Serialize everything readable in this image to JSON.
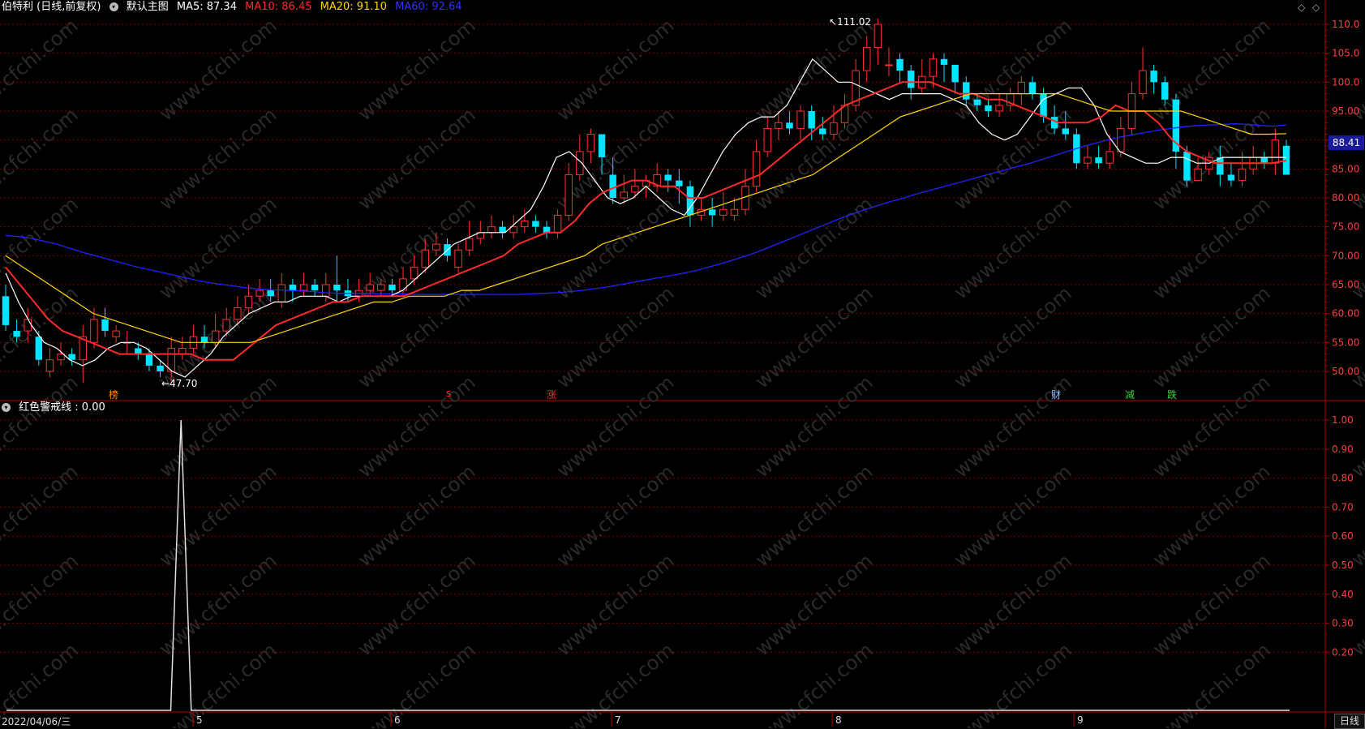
{
  "header": {
    "stock_name": "伯特利 (日线,前复权)",
    "chart_label": "默认主图",
    "ma": [
      {
        "label": "MA5: 87.34",
        "color": "#ffffff"
      },
      {
        "label": "MA10: 86.45",
        "color": "#ff2a2a"
      },
      {
        "label": "MA20: 91.10",
        "color": "#ffd700"
      },
      {
        "label": "MA60: 92.64",
        "color": "#2323ff"
      }
    ]
  },
  "indicator": {
    "label": "红色警戒线 : 0.00"
  },
  "price_axis": {
    "ticks": [
      "110.0",
      "105.0",
      "100.0",
      "95.00",
      "90.00",
      "85.00",
      "80.00",
      "75.00",
      "70.00",
      "65.00",
      "60.00",
      "55.00",
      "50.00"
    ],
    "current_price": "88.41"
  },
  "indicator_axis": {
    "ticks": [
      "1.00",
      "0.90",
      "0.80",
      "0.70",
      "0.60",
      "0.50",
      "0.40",
      "0.30",
      "0.20"
    ]
  },
  "annotations": {
    "high": "111.02",
    "low": "47.70"
  },
  "event_marks": [
    {
      "text": "榜",
      "color": "#ff8c00"
    },
    {
      "text": "s",
      "color": "#ff2a2a"
    },
    {
      "text": "涨",
      "color": "#ff2a2a"
    },
    {
      "text": "财",
      "color": "#8fb8ff"
    },
    {
      "text": "减",
      "color": "#3ad63a"
    },
    {
      "text": "跌",
      "color": "#3ad63a"
    }
  ],
  "bottom_bar": {
    "start_date": "2022/04/06/三",
    "months": [
      "5",
      "6",
      "7",
      "8",
      "9"
    ],
    "period_tab": "日线"
  },
  "watermark": "www.cfchi.com",
  "colors": {
    "up": "#ff3232",
    "down": "#00e5ff",
    "grid": "#7a0000",
    "axis": "#b00000",
    "ma5": "#ffffff",
    "ma10": "#ff2a2a",
    "ma20": "#ffd700",
    "ma60": "#2323ff"
  },
  "chart_data": [
    {
      "type": "candlestick",
      "title": "伯特利 (日线,前复权)",
      "ylim": [
        46,
        113
      ],
      "x_start": "2022/04/06",
      "series": [
        {
          "name": "MA60",
          "values": [
            73.5,
            73.3,
            73.0,
            72.5,
            72.0,
            71.3,
            70.6,
            70.0,
            69.4,
            68.8,
            68.2,
            67.7,
            67.2,
            66.7,
            66.2,
            65.7,
            65.3,
            65.0,
            64.7,
            64.4,
            64.2,
            64.1,
            64.0,
            63.9,
            63.8,
            63.6,
            63.5,
            63.5,
            63.5,
            63.4,
            63.4,
            63.4,
            63.3,
            63.3,
            63.3,
            63.3,
            63.3,
            63.3,
            63.3,
            63.3,
            63.3,
            63.4,
            63.5,
            63.6,
            63.8,
            64.0,
            64.3,
            64.6,
            65.0,
            65.4,
            65.8,
            66.2,
            66.6,
            67.0,
            67.5,
            68.1,
            68.7,
            69.4,
            70.1,
            70.9,
            71.8,
            72.7,
            73.6,
            74.5,
            75.4,
            76.3,
            77.1,
            77.9,
            78.6,
            79.3,
            79.9,
            80.6,
            81.2,
            81.8,
            82.4,
            83.0,
            83.6,
            84.2,
            84.8,
            85.4,
            86.0,
            86.7,
            87.4,
            88.1,
            88.8,
            89.4,
            90.0,
            90.5,
            90.9,
            91.3,
            91.7,
            92.0,
            92.3,
            92.5,
            92.6,
            92.7,
            92.8,
            92.7,
            92.5,
            92.4,
            92.6
          ]
        },
        {
          "name": "MA5",
          "values": [
            67,
            62,
            58,
            55,
            54,
            52,
            51,
            52,
            54,
            55,
            55,
            54,
            52,
            50,
            49,
            51,
            53,
            56,
            58,
            60,
            61,
            62,
            62,
            63,
            63,
            63,
            62,
            63,
            63,
            63,
            63,
            64,
            66,
            68,
            70,
            72,
            73,
            74,
            74,
            74,
            76,
            78,
            82,
            87,
            88,
            86,
            83,
            80,
            79,
            80,
            82,
            80,
            78,
            77,
            80,
            84,
            88,
            91,
            93,
            94,
            94,
            96,
            100,
            104,
            102,
            100,
            100,
            99,
            98,
            97,
            98,
            98,
            98,
            98,
            97,
            96,
            93,
            91,
            90,
            91,
            94,
            97,
            98,
            99,
            99,
            96,
            91,
            88,
            87,
            86,
            86,
            87,
            87,
            86,
            86,
            87,
            87,
            87,
            87,
            87,
            87
          ]
        },
        {
          "name": "MA10",
          "values": [
            68,
            65,
            62,
            59,
            57,
            56,
            55,
            54,
            53,
            53,
            53,
            53,
            53,
            53,
            52,
            52,
            52,
            54,
            56,
            58,
            59,
            60,
            61,
            62,
            62,
            63,
            63,
            63,
            63,
            64,
            65,
            66,
            67,
            68,
            69,
            70,
            72,
            73,
            74,
            74,
            76,
            79,
            81,
            82,
            83,
            83,
            82,
            82,
            80,
            80,
            81,
            82,
            83,
            84,
            86,
            88,
            90,
            92,
            94,
            96,
            97,
            98,
            99,
            100,
            100,
            100,
            99,
            98,
            98,
            97,
            97,
            96,
            95,
            94,
            93,
            93,
            93,
            94,
            96,
            95,
            95,
            93,
            90,
            88,
            87,
            86,
            86,
            86,
            86,
            86,
            86.45
          ]
        },
        {
          "name": "MA20",
          "values": [
            70,
            68,
            66,
            64,
            62,
            60,
            59,
            58,
            57,
            56,
            55,
            55,
            55,
            55,
            55,
            56,
            57,
            58,
            59,
            60,
            61,
            62,
            62,
            63,
            63,
            63,
            64,
            64,
            65,
            66,
            67,
            68,
            69,
            70,
            72,
            73,
            74,
            75,
            76,
            77,
            78,
            79,
            80,
            81,
            82,
            83,
            84,
            86,
            88,
            90,
            92,
            94,
            95,
            96,
            97,
            98,
            98,
            98,
            98,
            98,
            98,
            97,
            96,
            95,
            95,
            95,
            95,
            95,
            94,
            93,
            92,
            91,
            91,
            91.1
          ]
        }
      ]
    },
    {
      "type": "line",
      "title": "红色警戒线",
      "ylim": [
        0,
        1.0
      ],
      "series": [
        {
          "name": "红色警戒线",
          "values": [
            0,
            0,
            0,
            0,
            0,
            0,
            0,
            0,
            0,
            0,
            0,
            0,
            0,
            0,
            0,
            0,
            0,
            1,
            0,
            0,
            0,
            0,
            0,
            0,
            0,
            0,
            0,
            0,
            0,
            0,
            0,
            0,
            0,
            0,
            0,
            0,
            0,
            0,
            0,
            0,
            0,
            0,
            0,
            0,
            0,
            0,
            0,
            0,
            0,
            0,
            0,
            0,
            0,
            0,
            0,
            0,
            0,
            0,
            0,
            0,
            0,
            0,
            0,
            0,
            0,
            0,
            0,
            0,
            0,
            0,
            0,
            0,
            0,
            0,
            0,
            0,
            0,
            0,
            0,
            0,
            0,
            0,
            0,
            0,
            0,
            0,
            0,
            0,
            0,
            0,
            0,
            0,
            0,
            0,
            0,
            0,
            0,
            0,
            0,
            0,
            0,
            0,
            0,
            0,
            0,
            0,
            0,
            0,
            0,
            0,
            0,
            0,
            0,
            0,
            0,
            0,
            0,
            0,
            0,
            0,
            0,
            0,
            0,
            0,
            0,
            0
          ]
        }
      ]
    }
  ]
}
